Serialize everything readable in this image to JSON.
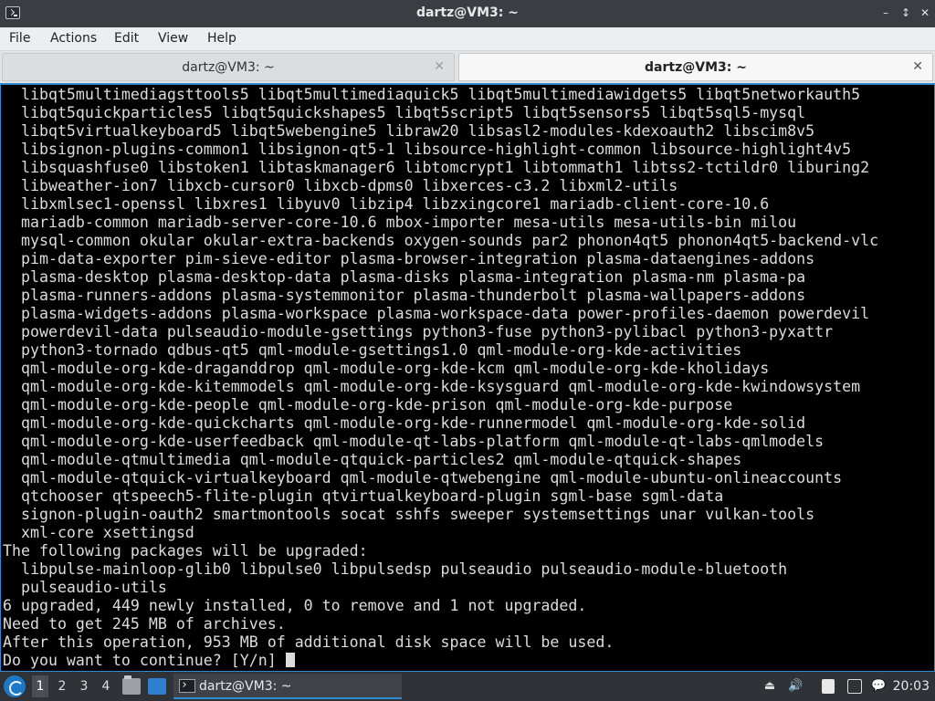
{
  "window": {
    "title": "dartz@VM3: ~",
    "minimize_glyph": "–",
    "maximize_glyph": "↕",
    "close_glyph": "✕"
  },
  "menubar": {
    "items": [
      "File",
      "Actions",
      "Edit",
      "View",
      "Help"
    ]
  },
  "tabs": [
    {
      "label": "dartz@VM3: ~",
      "active": false
    },
    {
      "label": "dartz@VM3: ~",
      "active": true
    }
  ],
  "terminal": {
    "lines": [
      "  libqt5multimediagsttools5 libqt5multimediaquick5 libqt5multimediawidgets5 libqt5networkauth5",
      "  libqt5quickparticles5 libqt5quickshapes5 libqt5script5 libqt5sensors5 libqt5sql5-mysql",
      "  libqt5virtualkeyboard5 libqt5webengine5 libraw20 libsasl2-modules-kdexoauth2 libscim8v5",
      "  libsignon-plugins-common1 libsignon-qt5-1 libsource-highlight-common libsource-highlight4v5",
      "  libsquashfuse0 libstoken1 libtaskmanager6 libtomcrypt1 libtommath1 libtss2-tctildr0 liburing2",
      "  libweather-ion7 libxcb-cursor0 libxcb-dpms0 libxerces-c3.2 libxml2-utils",
      "  libxmlsec1-openssl libxres1 libyuv0 libzip4 libzxingcore1 mariadb-client-core-10.6",
      "  mariadb-common mariadb-server-core-10.6 mbox-importer mesa-utils mesa-utils-bin milou",
      "  mysql-common okular okular-extra-backends oxygen-sounds par2 phonon4qt5 phonon4qt5-backend-vlc",
      "  pim-data-exporter pim-sieve-editor plasma-browser-integration plasma-dataengines-addons",
      "  plasma-desktop plasma-desktop-data plasma-disks plasma-integration plasma-nm plasma-pa",
      "  plasma-runners-addons plasma-systemmonitor plasma-thunderbolt plasma-wallpapers-addons",
      "  plasma-widgets-addons plasma-workspace plasma-workspace-data power-profiles-daemon powerdevil",
      "  powerdevil-data pulseaudio-module-gsettings python3-fuse python3-pylibacl python3-pyxattr",
      "  python3-tornado qdbus-qt5 qml-module-gsettings1.0 qml-module-org-kde-activities",
      "  qml-module-org-kde-draganddrop qml-module-org-kde-kcm qml-module-org-kde-kholidays",
      "  qml-module-org-kde-kitemmodels qml-module-org-kde-ksysguard qml-module-org-kde-kwindowsystem",
      "  qml-module-org-kde-people qml-module-org-kde-prison qml-module-org-kde-purpose",
      "  qml-module-org-kde-quickcharts qml-module-org-kde-runnermodel qml-module-org-kde-solid",
      "  qml-module-org-kde-userfeedback qml-module-qt-labs-platform qml-module-qt-labs-qmlmodels",
      "  qml-module-qtmultimedia qml-module-qtquick-particles2 qml-module-qtquick-shapes",
      "  qml-module-qtquick-virtualkeyboard qml-module-qtwebengine qml-module-ubuntu-onlineaccounts",
      "  qtchooser qtspeech5-flite-plugin qtvirtualkeyboard-plugin sgml-base sgml-data",
      "  signon-plugin-oauth2 smartmontools socat sshfs sweeper systemsettings unar vulkan-tools",
      "  xml-core xsettingsd",
      "The following packages will be upgraded:",
      "  libpulse-mainloop-glib0 libpulse0 libpulsedsp pulseaudio pulseaudio-module-bluetooth",
      "  pulseaudio-utils",
      "6 upgraded, 449 newly installed, 0 to remove and 1 not upgraded.",
      "Need to get 245 MB of archives.",
      "After this operation, 953 MB of additional disk space will be used."
    ],
    "prompt": "Do you want to continue? [Y/n] "
  },
  "taskbar": {
    "workspaces": [
      "1",
      "2",
      "3",
      "4"
    ],
    "active_workspace": "1",
    "task_label": "dartz@VM3: ~",
    "clock": "20:03"
  },
  "colors": {
    "accent": "#2f8ad4",
    "terminal_bg": "#000000",
    "terminal_fg": "#dcdcdc",
    "titlebar_bg": "#3a3d42",
    "taskbar_bg": "#2f3237"
  }
}
